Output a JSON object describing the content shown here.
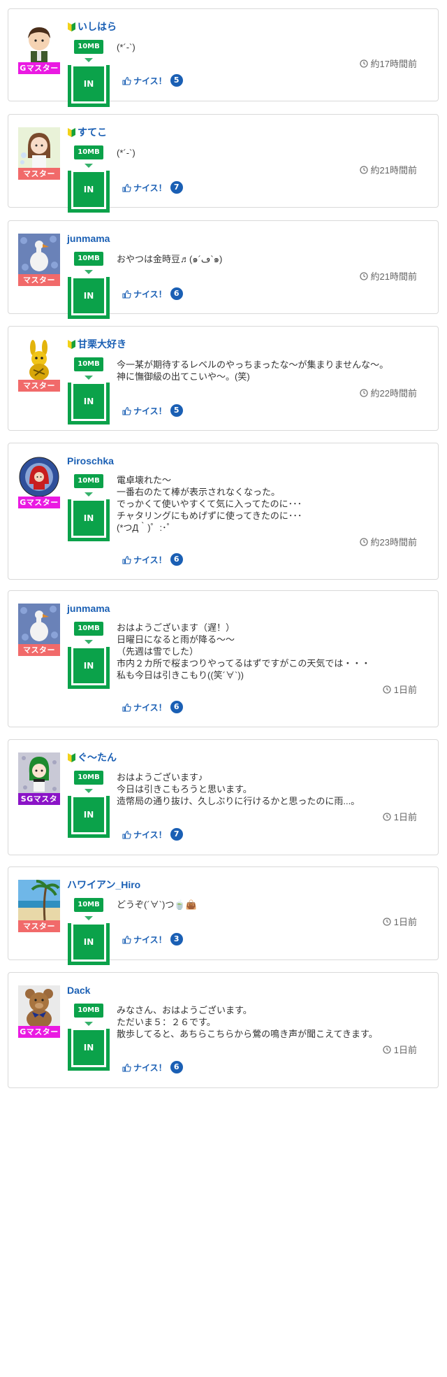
{
  "labels": {
    "size": "10MB",
    "in": "IN",
    "nice": "ナイス！"
  },
  "badge_colors": {
    "Gマスター": "#ea1ae2",
    "マスター": "#f16a6a",
    "SGマスタ": "#8b14c7"
  },
  "posts": [
    {
      "name": "いしはら",
      "beginner": true,
      "rank": "Gマスター",
      "avatar": "anime-boy-icon",
      "lines": [
        "(*´-`)"
      ],
      "time": "約17時間前",
      "nice": "5"
    },
    {
      "name": "すてこ",
      "beginner": true,
      "rank": "マスター",
      "avatar": "anime-girl-icon",
      "lines": [
        "(*´-`)"
      ],
      "time": "約21時間前",
      "nice": "7"
    },
    {
      "name": "junmama",
      "beginner": false,
      "rank": "マスター",
      "avatar": "swan-flowers-icon",
      "lines": [
        "おやつは金時豆♬(๑´ڡ`๑)"
      ],
      "time": "約21時間前",
      "nice": "6"
    },
    {
      "name": "甘栗大好き",
      "beginner": true,
      "rank": "マスター",
      "avatar": "yellow-rabbit-icon",
      "lines": [
        "今一某が期待するレベルのやっちまったな〜が集まりませんな〜。",
        "神に憮御級の出てこいや〜。(笑)"
      ],
      "time": "約22時間前",
      "nice": "5"
    },
    {
      "name": "Piroschka",
      "beginner": false,
      "rank": "Gマスター",
      "avatar": "red-hood-icon",
      "lines": [
        "電卓壊れた〜",
        "一番右のたて棒が表示されなくなった。",
        "でっかくて使いやすくて気に入ってたのに･･･",
        "チャタリングにもめげずに使ってきたのに･･･",
        "(*つД｀)゜:･゜"
      ],
      "time": "約23時間前",
      "nice": "6"
    },
    {
      "name": "junmama",
      "beginner": false,
      "rank": "マスター",
      "avatar": "swan-flowers-icon",
      "lines": [
        "おはようございます（遅！）",
        "日曜日になると雨が降る〜〜",
        "（先週は雪でした）",
        "市内２カ所で桜まつりやってるはずですがこの天気では・・・",
        "私も今日は引きこもり((笑´∀`))"
      ],
      "time": "1日前",
      "nice": "6"
    },
    {
      "name": "ぐ〜たん",
      "beginner": true,
      "rank": "SGマスタ",
      "avatar": "green-hair-girl-icon",
      "lines": [
        "おはようございます♪",
        "今日は引きこもろうと思います。",
        "造幣局の通り抜け、久しぶりに行けるかと思ったのに雨...。"
      ],
      "time": "1日前",
      "nice": "7"
    },
    {
      "name": "ハワイアン_Hiro",
      "beginner": false,
      "rank": "マスター",
      "avatar": "beach-palm-icon",
      "lines": [
        "どうぞ(´∀`)つ🍵👜"
      ],
      "time": "1日前",
      "nice": "3"
    },
    {
      "name": "Dack",
      "beginner": false,
      "rank": "Gマスター",
      "avatar": "teddy-bear-icon",
      "lines": [
        "みなさん、おはようございます。",
        "ただいま５：２６です。",
        "散歩してると、あちらこちらから鶯の鳴き声が聞こえてきます。"
      ],
      "time": "1日前",
      "nice": "6"
    }
  ]
}
